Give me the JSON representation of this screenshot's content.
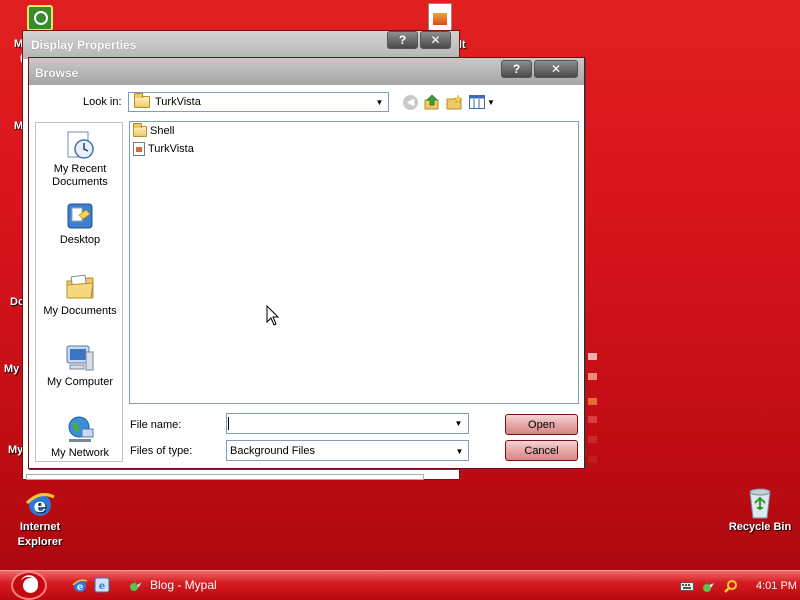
{
  "desktop": {
    "icons": [
      {
        "label": "Idefault"
      },
      {
        "label": "Internet\nExplorer",
        "line1": "Internet",
        "line2": "Explorer"
      },
      {
        "label": "Recycle Bin"
      }
    ],
    "partial_labels": [
      "M",
      "(",
      "M",
      "Do",
      "My",
      "My"
    ]
  },
  "display_properties": {
    "title": "Display Properties",
    "help_glyph": "?",
    "close_glyph": "✕"
  },
  "browse_dialog": {
    "title": "Browse",
    "help_glyph": "?",
    "close_glyph": "✕",
    "look_in_label": "Look in:",
    "look_in_value": "TurkVista",
    "places": [
      {
        "line1": "My Recent",
        "line2": "Documents",
        "icon": "recent-documents-icon"
      },
      {
        "line1": "Desktop",
        "line2": "",
        "icon": "desktop-icon"
      },
      {
        "line1": "My Documents",
        "line2": "",
        "icon": "my-documents-icon"
      },
      {
        "line1": "My Computer",
        "line2": "",
        "icon": "my-computer-icon"
      },
      {
        "line1": "My Network",
        "line2": "",
        "icon": "my-network-icon"
      }
    ],
    "files": [
      {
        "name": "Shell",
        "type": "folder"
      },
      {
        "name": "TurkVista",
        "type": "file"
      }
    ],
    "file_name_label": "File name:",
    "file_name_value": "",
    "files_of_type_label": "Files of type:",
    "files_of_type_value": "Background Files",
    "open_button": "Open",
    "cancel_button": "Cancel"
  },
  "taskbar": {
    "task_item": "Blog - Mypal",
    "clock": "4:01 PM"
  },
  "colors": {
    "desktop_red": "#d8141c",
    "taskbar_red": "#c40a10",
    "button_pink": "#e7a7a7"
  }
}
